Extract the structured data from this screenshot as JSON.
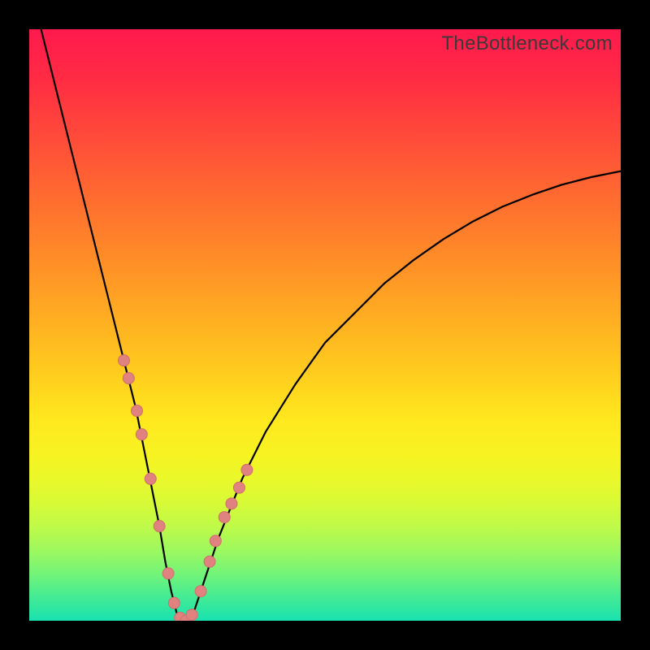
{
  "watermark": "TheBottleneck.com",
  "colors": {
    "background": "#000000",
    "curve": "#000000",
    "dot_fill": "#e08380",
    "dot_stroke": "#d06e6b"
  },
  "chart_data": {
    "type": "line",
    "title": "",
    "xlabel": "",
    "ylabel": "",
    "xlim": [
      0,
      100
    ],
    "ylim": [
      0,
      100
    ],
    "grid": false,
    "series": [
      {
        "name": "bottleneck-curve",
        "x": [
          2,
          4,
          6,
          8,
          10,
          12,
          14,
          16,
          18,
          20,
          21,
          22,
          23,
          24,
          25,
          26,
          27,
          28,
          30,
          32,
          34,
          36,
          40,
          45,
          50,
          55,
          60,
          65,
          70,
          75,
          80,
          85,
          90,
          95,
          100
        ],
        "y": [
          100,
          92,
          84,
          76,
          68,
          60,
          52,
          44,
          36,
          26,
          21,
          16,
          10,
          5,
          1,
          0,
          0,
          2,
          8,
          14,
          19,
          24,
          32,
          40,
          47,
          52,
          57,
          61,
          64.5,
          67.5,
          70,
          72,
          73.7,
          75,
          76
        ]
      }
    ],
    "scatter": {
      "name": "sample-points",
      "x": [
        16.0,
        16.8,
        18.2,
        19.0,
        20.5,
        22.0,
        23.5,
        24.5,
        25.5,
        26.5,
        27.5,
        29.0,
        30.5,
        31.5,
        33.0,
        34.2,
        35.5,
        36.8
      ],
      "y": [
        44.0,
        41.0,
        35.5,
        31.5,
        24.0,
        16.0,
        8.0,
        3.0,
        0.5,
        0.0,
        1.0,
        5.0,
        10.0,
        13.5,
        17.5,
        19.8,
        22.5,
        25.5
      ],
      "r": 7
    }
  }
}
